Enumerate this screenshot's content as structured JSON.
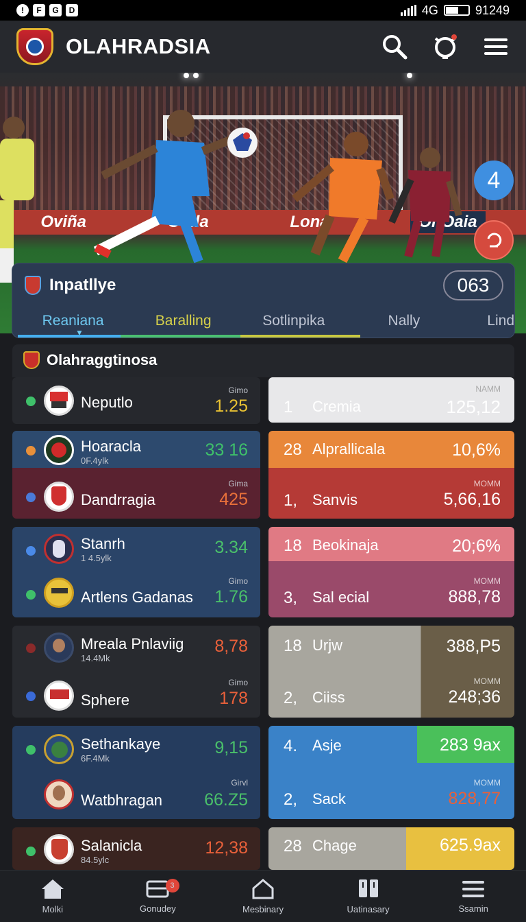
{
  "status_bar": {
    "left_icons": [
      "!",
      "F",
      "G",
      "D"
    ],
    "battery_text": "4G",
    "time": "91249"
  },
  "header": {
    "title": "OLAHRADSIA"
  },
  "hero": {
    "ads": [
      "Oviña",
      "Oqlla",
      "Lona",
      "OnOaia"
    ],
    "fab_count": "4"
  },
  "league": {
    "title": "Inpatllye",
    "count": "063",
    "tabs": [
      "Reaniana",
      "Baralling",
      "Sotlinpika",
      "Nally",
      "Lind"
    ]
  },
  "section": {
    "title": "Olahraggtinosa"
  },
  "matches": [
    {
      "home": {
        "name": "Neputlo",
        "sub": "",
        "score": "1.25",
        "caption": "Gimo",
        "dot": "#3fc06a",
        "color": "#e9c233"
      },
      "away": null,
      "bet": {
        "top_num": "1",
        "top_name": "Cremia",
        "top_val": "125,12",
        "top_cap": "NAMM",
        "style": "white"
      }
    },
    {
      "home": {
        "name": "Hoaracla",
        "sub": "0F.4ylk",
        "score": "33 16",
        "dot": "#e8903a",
        "color": "#3fc06a"
      },
      "away": {
        "name": "Dandrragia",
        "sub": "",
        "score": "425",
        "caption": "Gima",
        "dot": "#4a7ad8",
        "color": "#e8703a"
      },
      "bet": {
        "top_num": "28",
        "top_name": "Alprallicala",
        "top_val": "10,6%",
        "bot_num": "1,",
        "bot_name": "Sanvis",
        "bot_val": "5,66,16",
        "bot_cap": "MOMM",
        "style": "orange-red"
      }
    },
    {
      "home": {
        "name": "Stanrh",
        "sub": "1 4.5ylk",
        "score": "3.34",
        "dot": "#4a8ae8",
        "color": "#4ac06a"
      },
      "away": {
        "name": "Artlens Gadanas",
        "sub": "",
        "score": "1.76",
        "caption": "Gimo",
        "dot": "#3fc06a",
        "color": "#4ac06a"
      },
      "bet": {
        "top_num": "18",
        "top_name": "Beokinaja",
        "top_val": "20;6%",
        "bot_num": "3,",
        "bot_name": "Sal ecial",
        "bot_val": "888,78",
        "bot_cap": "MOMM",
        "style": "pink"
      }
    },
    {
      "home": {
        "name": "Mreala Pnlaviig",
        "sub": "14.4Mk",
        "score": "8,78",
        "dot": "#8a2a2a",
        "color": "#e8603a"
      },
      "away": {
        "name": "Sphere",
        "sub": "",
        "score": "178",
        "caption": "Gimo",
        "dot": "#3a6ad8",
        "color": "#e8603a"
      },
      "bet": {
        "top_num": "18",
        "top_name": "Urjw",
        "top_val": "388,P5",
        "bot_num": "2,",
        "bot_name": "Ciiss",
        "bot_val": "248;36",
        "bot_cap": "MOMM",
        "style": "gray"
      }
    },
    {
      "home": {
        "name": "Sethankaye",
        "sub": "6F.4Mk",
        "score": "9,15",
        "dot": "#3fc06a",
        "color": "#4ac06a"
      },
      "away": {
        "name": "Watbhragan",
        "sub": "",
        "score": "66.Z5",
        "caption": "Girvl",
        "dot": "",
        "color": "#4ac06a"
      },
      "bet": {
        "top_num": "4.",
        "top_name": "Asje",
        "top_val": "283 9ax",
        "bot_num": "2,",
        "bot_name": "Sack",
        "bot_val": "828,77",
        "bot_cap": "MOMM",
        "style": "blue"
      }
    },
    {
      "home": {
        "name": "Salanicla",
        "sub": "84.5ylc",
        "score": "12,38",
        "dot": "#3fc06a",
        "color": "#e8603a"
      },
      "away": null,
      "bet": {
        "top_num": "28",
        "top_name": "Chage",
        "top_val": "625.9ax",
        "style": "yellow"
      }
    }
  ],
  "bottom_nav": [
    {
      "label": "Molki",
      "icon": "home-icon"
    },
    {
      "label": "Gonudey",
      "icon": "wallet-icon",
      "badge": "3"
    },
    {
      "label": "Mesbinary",
      "icon": "house-outline-icon"
    },
    {
      "label": "Uatinasary",
      "icon": "book-icon"
    },
    {
      "label": "Ssamin",
      "icon": "menu-icon"
    }
  ]
}
